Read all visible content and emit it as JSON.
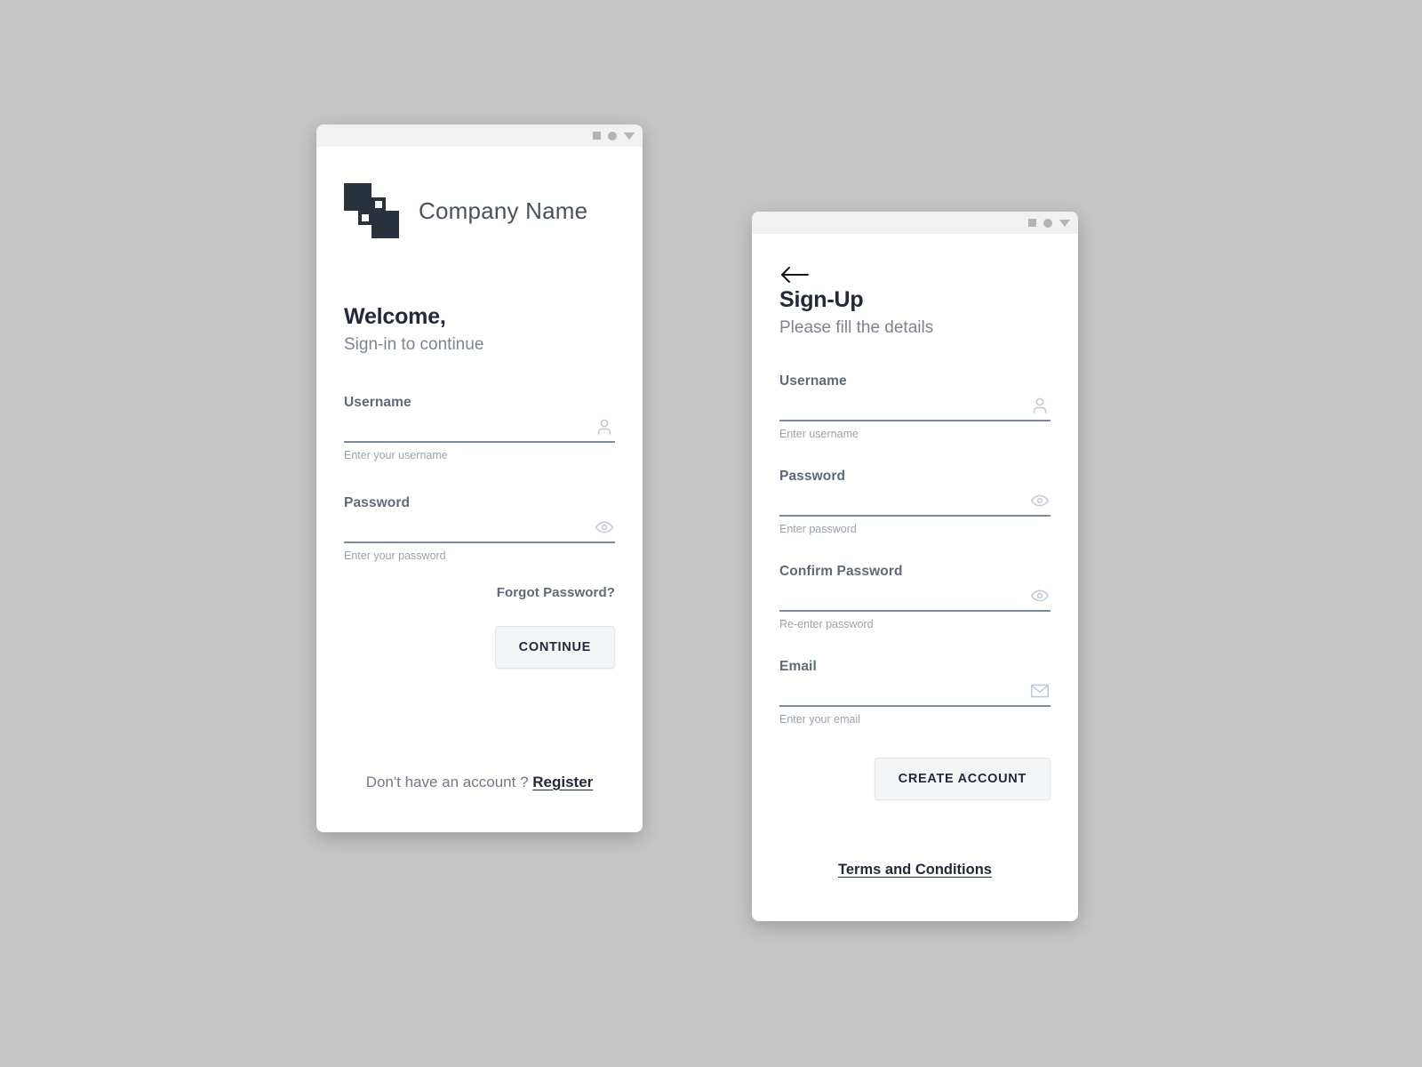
{
  "signin_card": {
    "titlebar": {
      "controls": [
        "square-icon",
        "circle-icon",
        "triangle-down-icon"
      ]
    },
    "brand": {
      "name": "Company Name",
      "logo_icon": "company-logo-icon",
      "logo_color": "#28313c"
    },
    "heading": {
      "title": "Welcome,",
      "subtitle": "Sign-in to continue"
    },
    "fields": [
      {
        "label": "Username",
        "value": "",
        "placeholder": "",
        "hint": "Enter your username",
        "icon": "person-icon"
      },
      {
        "label": "Password",
        "value": "",
        "placeholder": "",
        "hint": "Enter your password",
        "icon": "eye-icon"
      }
    ],
    "forgot_password_label": "Forgot Password?",
    "continue_label": "CONTINUE",
    "footer": {
      "text": "Don't have an account ?",
      "link": "Register"
    }
  },
  "signup_card": {
    "titlebar": {
      "controls": [
        "square-icon",
        "circle-icon",
        "triangle-down-icon"
      ]
    },
    "back_icon": "back-arrow-icon",
    "heading": {
      "title": "Sign-Up",
      "subtitle": "Please fill the details"
    },
    "fields": [
      {
        "label": "Username",
        "value": "",
        "placeholder": "",
        "hint": "Enter username",
        "icon": "person-icon"
      },
      {
        "label": "Password",
        "value": "",
        "placeholder": "",
        "hint": "Enter password",
        "icon": "eye-icon"
      },
      {
        "label": "Confirm Password",
        "value": "",
        "placeholder": "",
        "hint": "Re-enter password",
        "icon": "eye-icon"
      },
      {
        "label": "Email",
        "value": "",
        "placeholder": "",
        "hint": "Enter your email",
        "icon": "envelope-icon"
      }
    ],
    "create_account_label": "CREATE ACCOUNT",
    "terms_label": "Terms and Conditions"
  },
  "theme": {
    "background": "#c6c6c6",
    "card_background": "#ffffff",
    "titlebar_background": "#f1f1f1",
    "accent_dark": "#22293a",
    "label_color": "#5c6a7a",
    "hint_color": "#9aa3ad",
    "underline_color": "#7c8a9c",
    "button_background": "#f4f5f7"
  }
}
